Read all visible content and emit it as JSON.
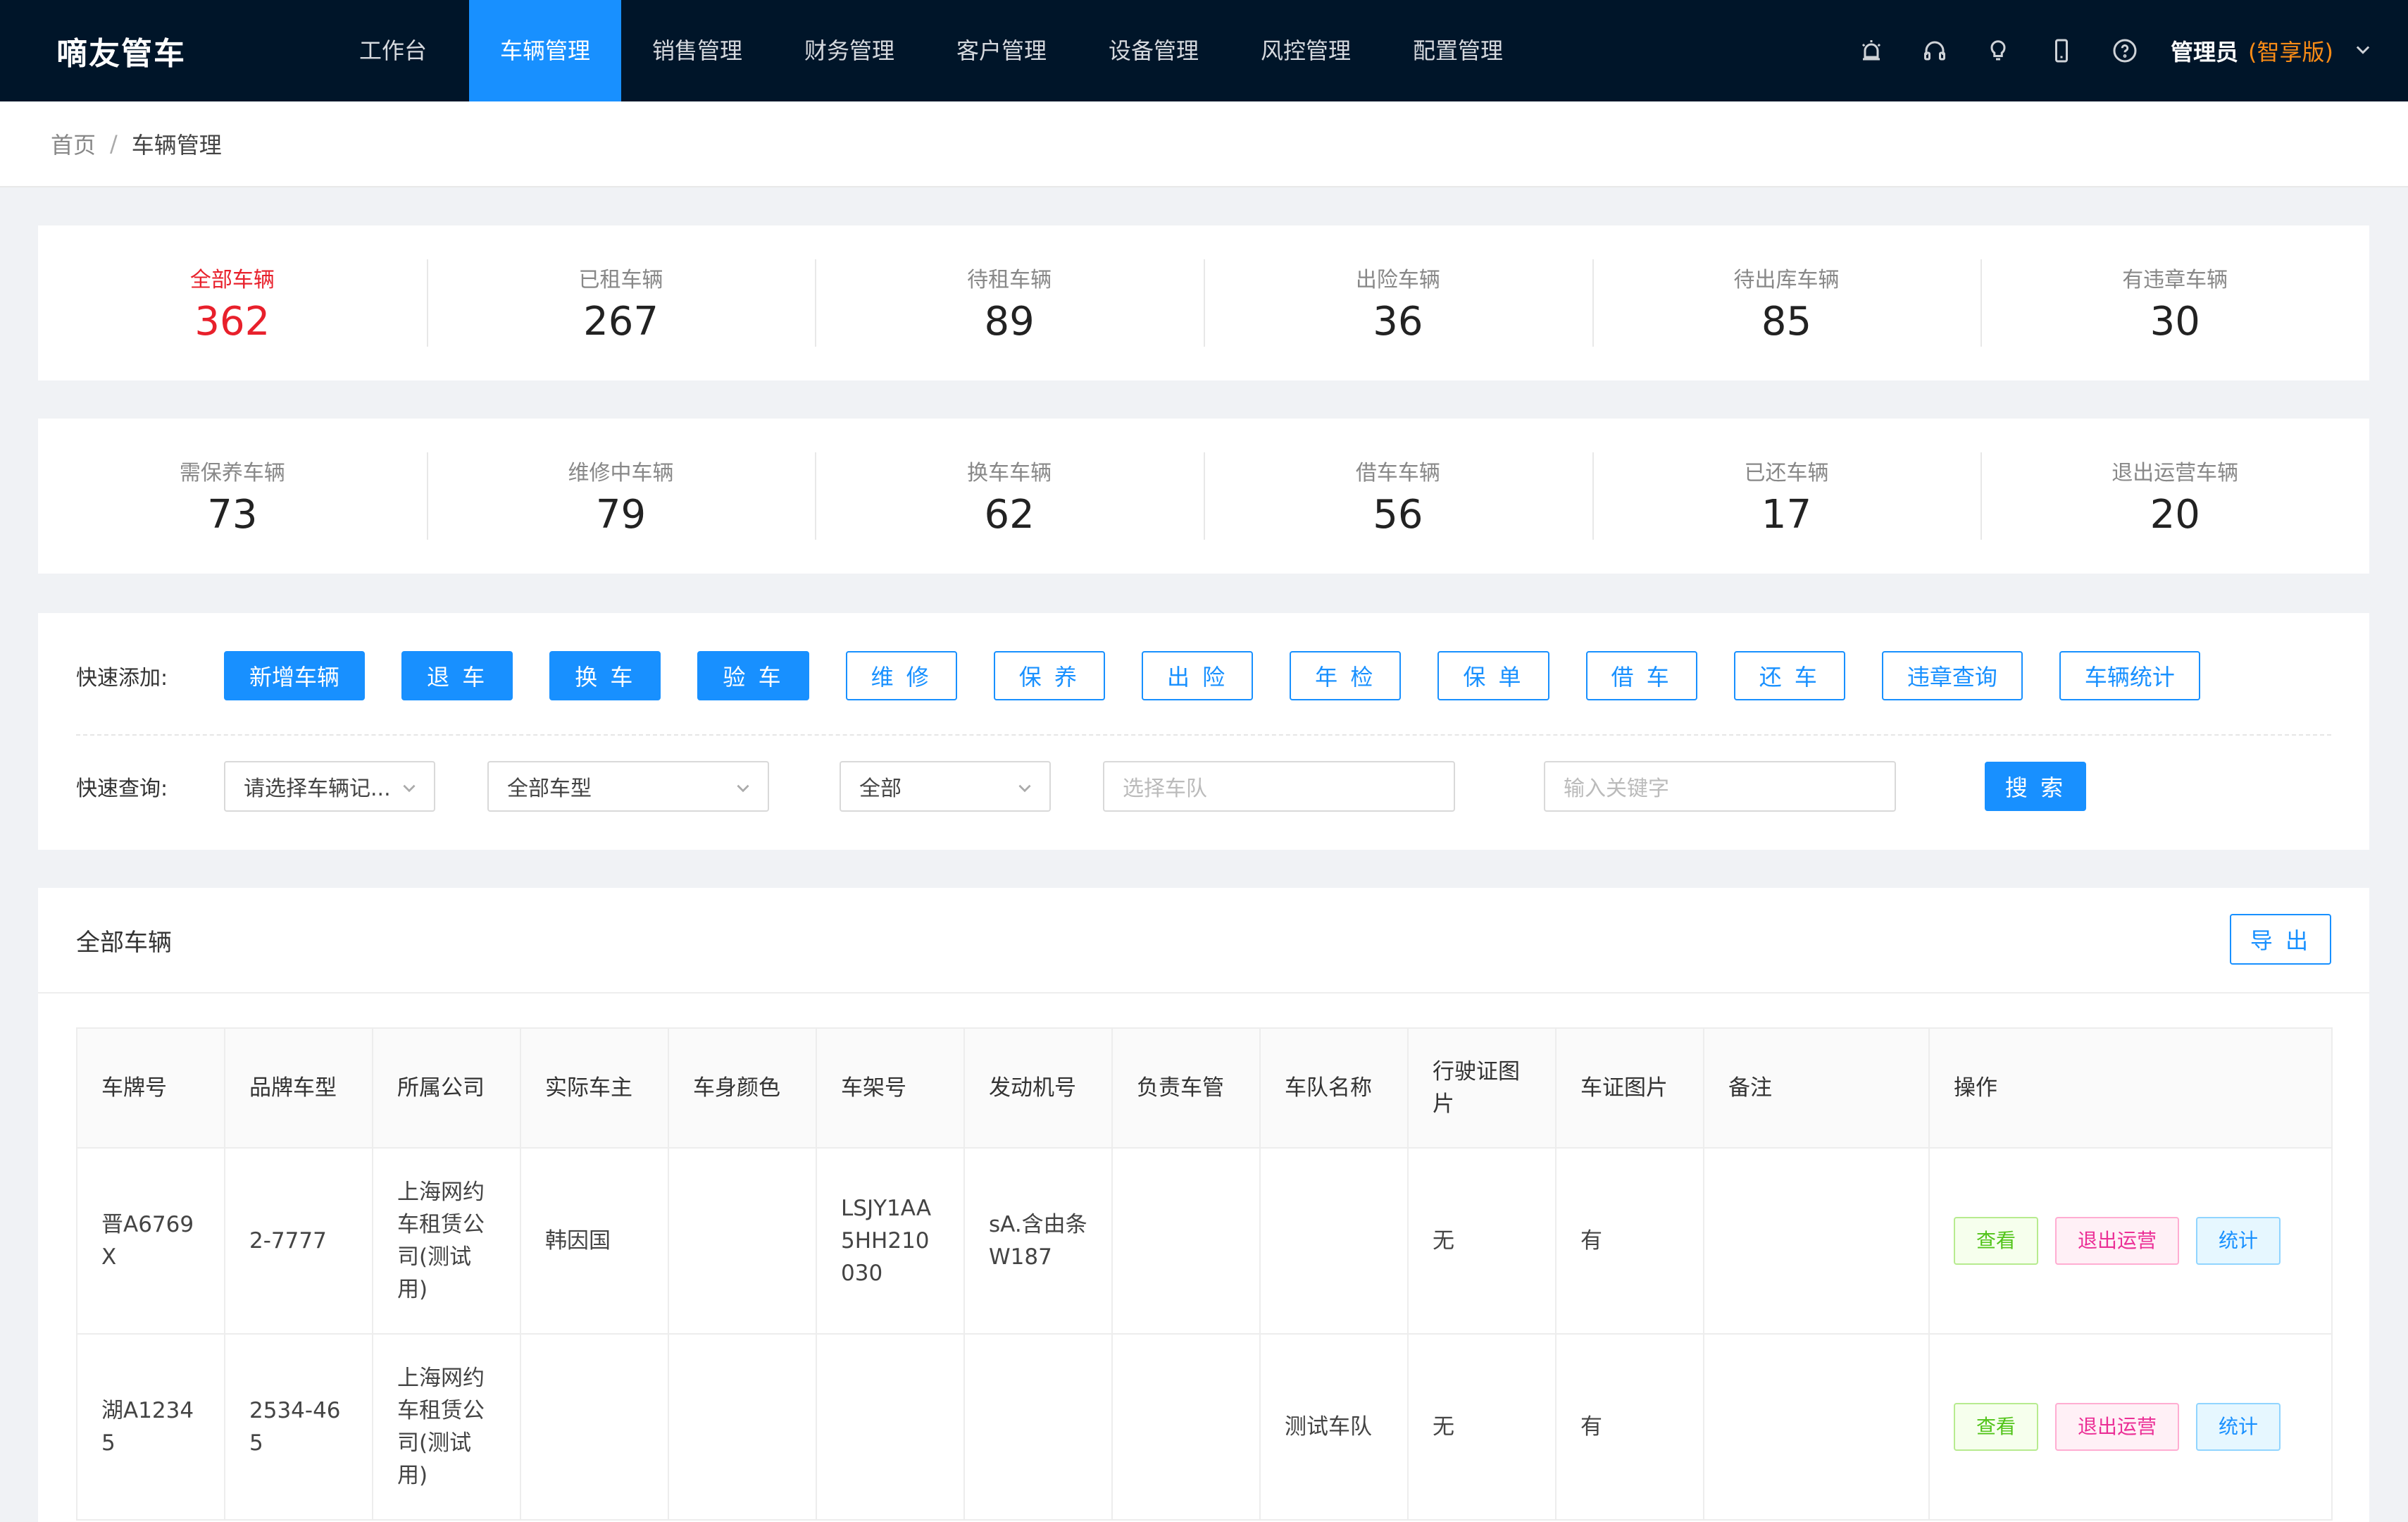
{
  "app": {
    "logo": "嘀友管车",
    "nav": [
      "工作台",
      "车辆管理",
      "销售管理",
      "财务管理",
      "客户管理",
      "设备管理",
      "风控管理",
      "配置管理"
    ],
    "active_nav": "车辆管理",
    "icons": [
      "alarm-icon",
      "headset-icon",
      "bulb-icon",
      "phone-icon",
      "help-icon"
    ],
    "user_name": "管理员",
    "user_edition": "(智享版)"
  },
  "breadcrumb": {
    "home": "首页",
    "separator": "/",
    "current": "车辆管理"
  },
  "stats_row1": [
    {
      "label": "全部车辆",
      "value": "362"
    },
    {
      "label": "已租车辆",
      "value": "267"
    },
    {
      "label": "待租车辆",
      "value": "89"
    },
    {
      "label": "出险车辆",
      "value": "36"
    },
    {
      "label": "待出库车辆",
      "value": "85"
    },
    {
      "label": "有违章车辆",
      "value": "30"
    }
  ],
  "stats_row2": [
    {
      "label": "需保养车辆",
      "value": "73"
    },
    {
      "label": "维修中车辆",
      "value": "79"
    },
    {
      "label": "换车车辆",
      "value": "62"
    },
    {
      "label": "借车车辆",
      "value": "56"
    },
    {
      "label": "已还车辆",
      "value": "17"
    },
    {
      "label": "退出运营车辆",
      "value": "20"
    }
  ],
  "quick_add": {
    "label": "快速添加:",
    "buttons": [
      "新增车辆",
      "退 车",
      "换 车",
      "验 车",
      "维 修",
      "保 养",
      "出 险",
      "年 检",
      "保 单",
      "借 车",
      "还 车",
      "违章查询",
      "车辆统计"
    ]
  },
  "quick_search": {
    "label": "快速查询:",
    "record_select": "请选择车辆记...",
    "type_select": "全部车型",
    "status_select": "全部",
    "fleet_placeholder": "选择车队",
    "keyword_placeholder": "输入关键字",
    "search_button": "搜 索"
  },
  "table": {
    "title": "全部车辆",
    "export": "导 出",
    "headers": [
      "车牌号",
      "品牌车型",
      "所属公司",
      "实际车主",
      "车身颜色",
      "车架号",
      "发动机号",
      "负责车管",
      "车队名称",
      "行驶证图片",
      "车证图片",
      "备注",
      "操作"
    ],
    "rows": [
      [
        "晋A6769X",
        "2-7777",
        "上海网约车租赁公司(测试用)",
        "韩因国",
        "",
        "LSJY1AA5HH210030",
        "sA.含由条W187",
        "",
        "",
        "无",
        "有",
        ""
      ],
      [
        "湖A12345",
        "2534-465",
        "上海网约车租赁公司(测试用)",
        "",
        "",
        "",
        "",
        "",
        "测试车队",
        "无",
        "有",
        ""
      ]
    ],
    "actions": [
      "查看",
      "退出运营",
      "统计"
    ]
  }
}
